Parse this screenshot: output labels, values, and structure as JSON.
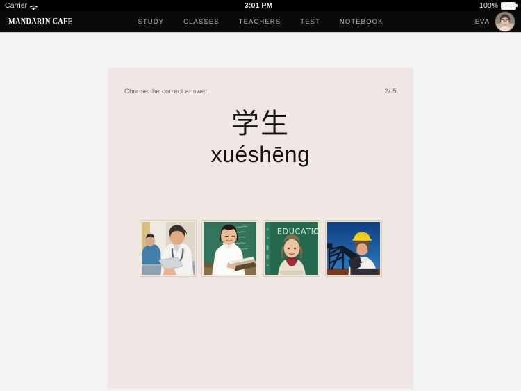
{
  "status_bar": {
    "carrier": "Carrier",
    "wifi_icon": "wifi-icon",
    "time": "3:01 PM",
    "battery_percent": "100%",
    "battery_icon": "battery-full-icon"
  },
  "navbar": {
    "brand": "MANDARIN CAFE",
    "links": [
      {
        "label": "STUDY"
      },
      {
        "label": "CLASSES"
      },
      {
        "label": "TEACHERS"
      },
      {
        "label": "TEST"
      },
      {
        "label": "NOTEBOOK"
      }
    ],
    "user": {
      "name": "EVA",
      "avatar_icon": "user-avatar-photo"
    }
  },
  "quiz_card": {
    "prompt": "Choose the correct answer",
    "counter": "2/ 5",
    "hanzi": "学生",
    "pinyin": "xuéshēng",
    "options": [
      {
        "alt": "doctor-with-tablet-photo"
      },
      {
        "alt": "teacher-with-book-at-chalkboard-photo"
      },
      {
        "alt": "student-in-front-of-education-chalkboard-photo"
      },
      {
        "alt": "engineer-with-hard-hat-at-oil-derrick-photo"
      }
    ]
  },
  "colors": {
    "navbar_bg": "#0a0a0a",
    "page_bg": "#f3f3f3",
    "card_bg": "#f0e7e4",
    "card_text": "#6f6460",
    "word_text": "#15130f",
    "option_border": "#ded1ab",
    "nav_link": "#b9b5b2"
  }
}
